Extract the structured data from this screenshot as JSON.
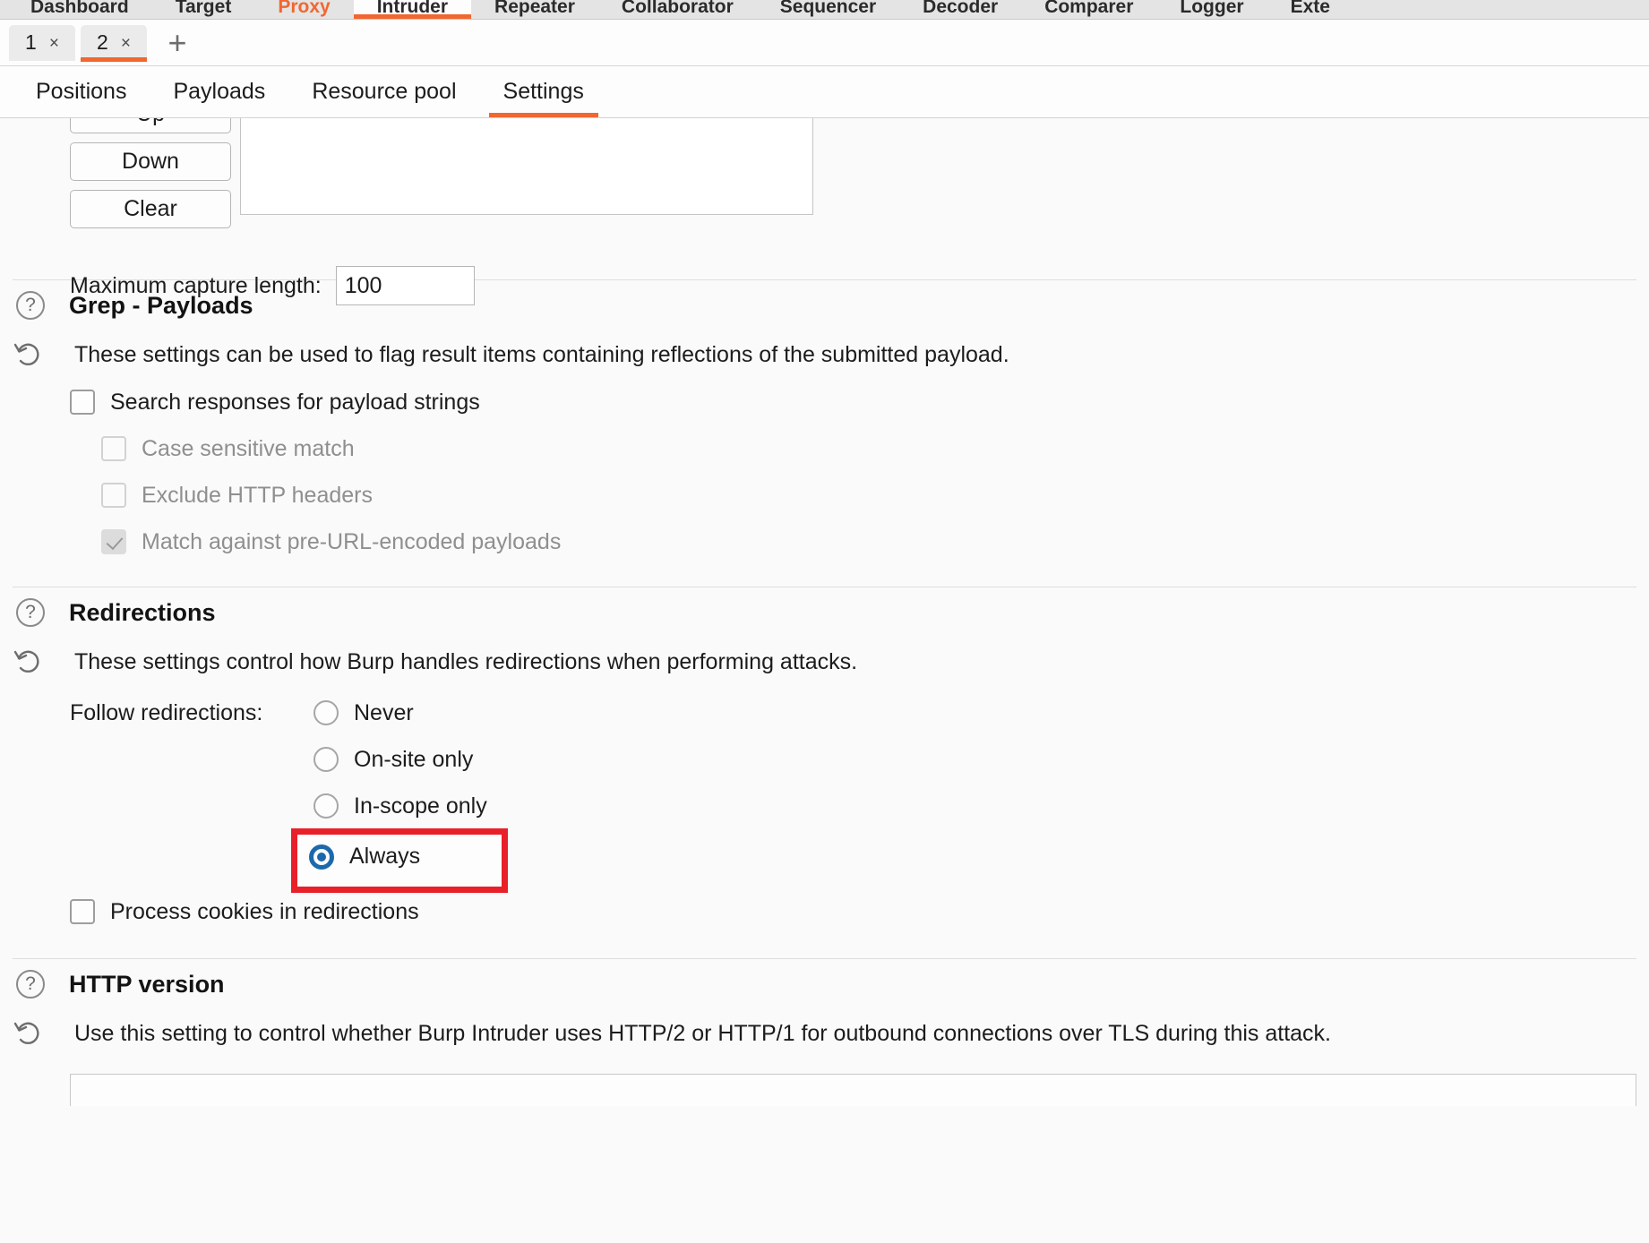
{
  "main_tabs": [
    {
      "label": "Dashboard",
      "state": "normal"
    },
    {
      "label": "Target",
      "state": "normal"
    },
    {
      "label": "Proxy",
      "state": "alert"
    },
    {
      "label": "Intruder",
      "state": "active"
    },
    {
      "label": "Repeater",
      "state": "normal"
    },
    {
      "label": "Collaborator",
      "state": "normal"
    },
    {
      "label": "Sequencer",
      "state": "normal"
    },
    {
      "label": "Decoder",
      "state": "normal"
    },
    {
      "label": "Comparer",
      "state": "normal"
    },
    {
      "label": "Logger",
      "state": "normal"
    },
    {
      "label": "Exte",
      "state": "normal"
    }
  ],
  "attack_tabs": {
    "items": [
      {
        "label": "1",
        "close": "×",
        "active": false
      },
      {
        "label": "2",
        "close": "×",
        "active": true
      }
    ],
    "add_label": "+"
  },
  "section_tabs": [
    {
      "label": "Positions",
      "active": false
    },
    {
      "label": "Payloads",
      "active": false
    },
    {
      "label": "Resource pool",
      "active": false
    },
    {
      "label": "Settings",
      "active": true
    }
  ],
  "grep_extract": {
    "buttons": {
      "up": "Up",
      "down": "Down",
      "clear": "Clear"
    },
    "max_capture_label": "Maximum capture length:",
    "max_capture_value": "100"
  },
  "grep_payloads": {
    "help_glyph": "?",
    "title": "Grep - Payloads",
    "description": "These settings can be used to flag result items containing reflections of the submitted payload.",
    "options": [
      {
        "label": "Search responses for payload strings",
        "checked": false,
        "disabled": false,
        "indent": false
      },
      {
        "label": "Case sensitive match",
        "checked": false,
        "disabled": true,
        "indent": true
      },
      {
        "label": "Exclude HTTP headers",
        "checked": false,
        "disabled": true,
        "indent": true
      },
      {
        "label": "Match against pre-URL-encoded payloads",
        "checked": true,
        "disabled": true,
        "indent": true
      }
    ]
  },
  "redirections": {
    "help_glyph": "?",
    "title": "Redirections",
    "description": "These settings control how Burp handles redirections when performing attacks.",
    "follow_label": "Follow redirections:",
    "radios": [
      {
        "label": "Never",
        "selected": false
      },
      {
        "label": "On-site only",
        "selected": false
      },
      {
        "label": "In-scope only",
        "selected": false
      },
      {
        "label": "Always",
        "selected": true
      }
    ],
    "process_cookies": {
      "label": "Process cookies in redirections",
      "checked": false
    }
  },
  "http_version": {
    "help_glyph": "?",
    "title": "HTTP version",
    "description": "Use this setting to control whether Burp Intruder uses HTTP/2 or HTTP/1 for outbound connections over TLS during this attack."
  },
  "colors": {
    "accent_orange": "#f26630",
    "highlight_red": "#e8202a",
    "radio_blue": "#1b69ad"
  }
}
